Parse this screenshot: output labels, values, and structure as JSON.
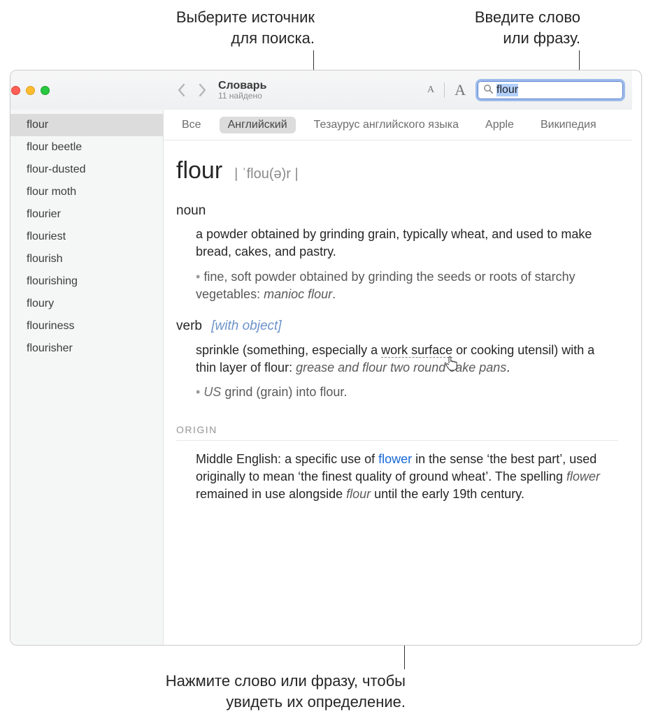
{
  "callouts": {
    "source": "Выберите источник\nдля поиска.",
    "search": "Введите слово\nили фразу.",
    "click": "Нажмите слово или фразу, чтобы\nувидеть их определение."
  },
  "window": {
    "title": "Словарь",
    "subtitle": "11 найдено"
  },
  "search": {
    "value": "flour"
  },
  "sidebar": {
    "items": [
      "flour",
      "flour beetle",
      "flour-dusted",
      "flour moth",
      "flourier",
      "flouriest",
      "flourish",
      "flourishing",
      "floury",
      "flouriness",
      "flourisher"
    ],
    "selected_index": 0
  },
  "sources": {
    "items": [
      "Все",
      "Английский",
      "Тезаурус английского языка",
      "Apple",
      "Википедия"
    ],
    "active_index": 1
  },
  "entry": {
    "headword": "flour",
    "pronunciation": "| ˈflou(ə)r |",
    "noun_label": "noun",
    "noun_def": "a powder obtained by grinding grain, typically wheat, and used to make bread, cakes, and pastry.",
    "noun_sub_prefix": "fine, soft powder obtained by grinding the seeds or roots of starchy vegetables: ",
    "noun_sub_example": "manioc flour",
    "verb_label": "verb",
    "verb_grammar": "[with object]",
    "verb_def_prefix": "sprinkle (something, especially a ",
    "verb_def_underlined": "work surface",
    "verb_def_suffix": " or cooking utensil) with a thin layer of flour: ",
    "verb_example": "grease and flour two round cake pans",
    "verb_sub_region": "US",
    "verb_sub_text": " grind (grain) into flour.",
    "origin_label": "ORIGIN",
    "origin_prefix": "Middle English: a specific use of ",
    "origin_link": "flower",
    "origin_mid": " in the sense ‘the best part’, used originally to mean ‘the finest quality of ground wheat’. The spelling ",
    "origin_italic1": "flower",
    "origin_mid2": " remained in use alongside ",
    "origin_italic2": "flour",
    "origin_suffix": " until the early 19th century."
  }
}
